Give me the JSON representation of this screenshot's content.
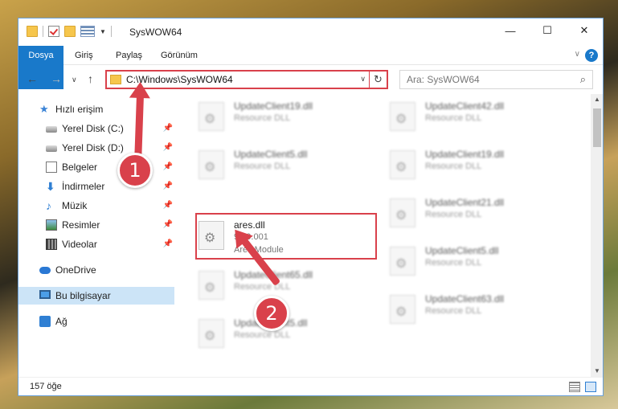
{
  "window": {
    "title": "SysWOW64",
    "controls": {
      "minimize": "—",
      "maximize": "☐",
      "close": "✕"
    }
  },
  "ribbon": {
    "tabs": [
      "Dosya",
      "Giriş",
      "Paylaş",
      "Görünüm"
    ],
    "help": "?"
  },
  "address": {
    "path": "C:\\Windows\\SysWOW64",
    "search_placeholder": "Ara: SysWOW64"
  },
  "sidebar": {
    "quick_access": "Hızlı erişim",
    "items": [
      {
        "label": "Yerel Disk (C:)",
        "icon": "drive-icon",
        "pinned": true
      },
      {
        "label": "Yerel Disk (D:)",
        "icon": "drive-icon",
        "pinned": true
      },
      {
        "label": "Belgeler",
        "icon": "document-icon",
        "pinned": true
      },
      {
        "label": "İndirmeler",
        "icon": "download-icon",
        "pinned": true
      },
      {
        "label": "Müzik",
        "icon": "music-icon",
        "pinned": true
      },
      {
        "label": "Resimler",
        "icon": "pictures-icon",
        "pinned": true
      },
      {
        "label": "Videolar",
        "icon": "video-icon",
        "pinned": true
      }
    ],
    "onedrive": "OneDrive",
    "this_pc": "Bu bilgisayar",
    "network": "Ağ"
  },
  "files": {
    "left": [
      {
        "name": "UpdateClient19.dll",
        "type": "Resource DLL"
      },
      {
        "name": "UpdateClient5.dll",
        "type": "Resource DLL"
      },
      {
        "name": "ares.dll",
        "type": "9.00.001",
        "desc": "Ares Module"
      },
      {
        "name": "UpdateClient65.dll",
        "type": "Resource DLL"
      },
      {
        "name": "UpdateClient5.dll",
        "type": "Resource DLL"
      }
    ],
    "right": [
      {
        "name": "UpdateClient42.dll",
        "type": "Resource DLL"
      },
      {
        "name": "UpdateClient19.dll",
        "type": "Resource DLL"
      },
      {
        "name": "UpdateClient21.dll",
        "type": "Resource DLL"
      },
      {
        "name": "UpdateClient5.dll",
        "type": "Resource DLL"
      },
      {
        "name": "UpdateClient63.dll",
        "type": "Resource DLL"
      }
    ]
  },
  "status": {
    "count": "157 öğe"
  },
  "annotations": {
    "step1": "1",
    "step2": "2"
  },
  "colors": {
    "accent": "#1979ca",
    "highlight": "#d9414b",
    "selection": "#cce4f7"
  }
}
